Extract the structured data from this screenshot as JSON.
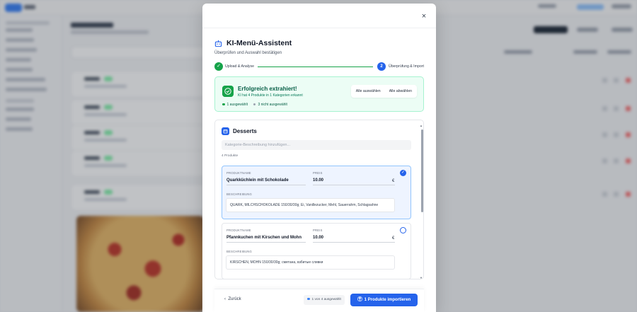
{
  "modal": {
    "close_label": "×",
    "title": "KI-Menü-Assistent",
    "subtitle": "Überprüfen und Auswahl bestätigen"
  },
  "stepper": {
    "step1": {
      "icon": "check-icon",
      "mark": "✓",
      "label": "Upload & Analyse"
    },
    "step2": {
      "number": "2",
      "label": "Überprüfung & Import"
    }
  },
  "success": {
    "title": "Erfolgreich extrahiert!",
    "subtitle": "KI hat 4 Produkte in 1 Kategorien erkannt",
    "selected_text": "1 ausgewählt",
    "unselected_text": "3 nicht ausgewählt",
    "select_all_label": "Alle auswählen",
    "deselect_all_label": "Alle abwählen"
  },
  "category": {
    "name": "Desserts",
    "description_placeholder": "Kategorie-Beschreibung hinzufügen...",
    "product_count": "4 Produkte",
    "field_labels": {
      "name": "PRODUKTNAME",
      "price": "PREIS",
      "description": "BESCHREIBUNG"
    },
    "products": [
      {
        "name": "Quarkküchlein mit Schokolade",
        "price": "10.00",
        "currency": "€",
        "description": "QUARK, MILCHSCHOKOLADE 150/30/30g; Ei, Vanillezucker, Mehl, Sauerrahm, Schlagsahne",
        "selected": true
      },
      {
        "name": "Pfannkuchen mit Kirschen und Mohn",
        "price": "10.00",
        "currency": "€",
        "description": "KIRSCHEN, MOHN 150/30/30g; сметана, взбитые сливки",
        "selected": false
      }
    ]
  },
  "footer": {
    "back_label": "Zurück",
    "selection_count": "1 von 4 ausgewählt",
    "import_label": "1 Produkte importieren"
  },
  "colors": {
    "accent": "#2563eb",
    "success": "#16a34a",
    "success_bg": "#ecfdf5"
  }
}
